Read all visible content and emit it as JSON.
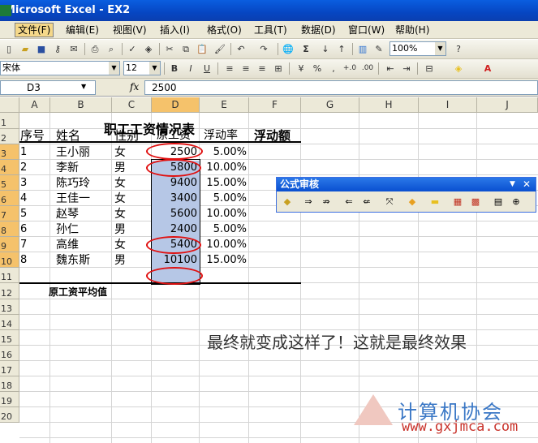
{
  "window": {
    "title": "Microsoft Excel - EX2"
  },
  "menu": [
    "文件(F)",
    "编辑(E)",
    "视图(V)",
    "插入(I)",
    "格式(O)",
    "工具(T)",
    "数据(D)",
    "窗口(W)",
    "帮助(H)"
  ],
  "toolbar": {
    "zoom": "100%",
    "font_name": "宋体",
    "font_size": "12",
    "sigma": "Σ",
    "bold": "B",
    "italic": "I",
    "underline": "U",
    "percent": "%"
  },
  "formula_bar": {
    "cell_ref": "D3",
    "fx": "fx",
    "value": "2500"
  },
  "columns": [
    "A",
    "B",
    "C",
    "D",
    "E",
    "F",
    "G",
    "H",
    "I",
    "J"
  ],
  "rows": [
    "1",
    "2",
    "3",
    "4",
    "5",
    "6",
    "7",
    "8",
    "9",
    "10",
    "11",
    "12",
    "13",
    "14",
    "15",
    "16",
    "17",
    "18",
    "19",
    "20"
  ],
  "sheet": {
    "title": "职工工资情况表",
    "headers": {
      "seq": "序号",
      "name": "姓名",
      "gender": "性别",
      "salary": "原工资",
      "rate": "浮动率",
      "amount": "浮动额"
    },
    "records": [
      {
        "seq": "1",
        "name": "王小丽",
        "gender": "女",
        "salary": "2500",
        "rate": "5.00%"
      },
      {
        "seq": "2",
        "name": "李新",
        "gender": "男",
        "salary": "5800",
        "rate": "10.00%"
      },
      {
        "seq": "3",
        "name": "陈巧玲",
        "gender": "女",
        "salary": "9400",
        "rate": "15.00%"
      },
      {
        "seq": "4",
        "name": "王佳一",
        "gender": "女",
        "salary": "3400",
        "rate": "5.00%"
      },
      {
        "seq": "5",
        "name": "赵琴",
        "gender": "女",
        "salary": "5600",
        "rate": "10.00%"
      },
      {
        "seq": "6",
        "name": "孙仁",
        "gender": "男",
        "salary": "2400",
        "rate": "5.00%"
      },
      {
        "seq": "7",
        "name": "高维",
        "gender": "女",
        "salary": "5400",
        "rate": "10.00%"
      },
      {
        "seq": "8",
        "name": "魏东斯",
        "gender": "男",
        "salary": "10100",
        "rate": "15.00%"
      }
    ],
    "avg_label": "原工资平均值"
  },
  "audit_toolbar": {
    "title": "公式审核"
  },
  "caption": "最终就变成这样了！这就是最终效果",
  "watermark": {
    "line1": "计算机协会",
    "line2": "www.gxjmca.com"
  },
  "colors": {
    "selection": "#b6c7e6",
    "circle": "#e01010",
    "titlebar": "#0a5ee0"
  }
}
